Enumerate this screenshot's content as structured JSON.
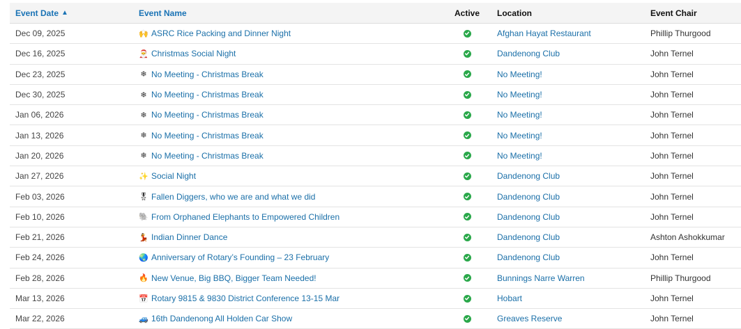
{
  "colors": {
    "link": "#1a6fa8",
    "active": "#2aa84a",
    "header_bg": "#f4f4f4"
  },
  "headers": {
    "date": "Event Date",
    "sort_indicator": "▲",
    "name": "Event Name",
    "active": "Active",
    "location": "Location",
    "chair": "Event Chair"
  },
  "rows": [
    {
      "date": "Dec 09, 2025",
      "icon": "raising-hands-icon",
      "emoji": "🙌",
      "name": "ASRC Rice Packing and Dinner Night",
      "location": "Afghan Hayat Restaurant",
      "chair": "Phillip Thurgood"
    },
    {
      "date": "Dec 16, 2025",
      "icon": "santa-icon",
      "emoji": "🎅",
      "name": "Christmas Social Night",
      "location": "Dandenong Club",
      "chair": "John Ternel"
    },
    {
      "date": "Dec 23, 2025",
      "icon": "snowflake-icon",
      "emoji": "❄",
      "name": "No Meeting - Christmas Break",
      "location": "No Meeting!",
      "chair": "John Ternel"
    },
    {
      "date": "Dec 30, 2025",
      "icon": "snowflake-icon",
      "emoji": "❄",
      "name": "No Meeting - Christmas Break",
      "location": "No Meeting!",
      "chair": "John Ternel"
    },
    {
      "date": "Jan 06, 2026",
      "icon": "snowflake-icon",
      "emoji": "❄",
      "name": "No Meeting - Christmas Break",
      "location": "No Meeting!",
      "chair": "John Ternel"
    },
    {
      "date": "Jan 13, 2026",
      "icon": "snowflake-icon",
      "emoji": "❄",
      "name": "No Meeting - Christmas Break",
      "location": "No Meeting!",
      "chair": "John Ternel"
    },
    {
      "date": "Jan 20, 2026",
      "icon": "snowflake-icon",
      "emoji": "❄",
      "name": "No Meeting - Christmas Break",
      "location": "No Meeting!",
      "chair": "John Ternel"
    },
    {
      "date": "Jan 27, 2026",
      "icon": "sparkles-icon",
      "emoji": "✨",
      "name": "Social Night",
      "location": "Dandenong Club",
      "chair": "John Ternel"
    },
    {
      "date": "Feb 03, 2026",
      "icon": "medal-icon",
      "emoji": "🎖",
      "name": "Fallen Diggers, who we are and what we did",
      "location": "Dandenong Club",
      "chair": "John Ternel"
    },
    {
      "date": "Feb 10, 2026",
      "icon": "elephant-icon",
      "emoji": "🐘",
      "name": "From Orphaned Elephants to Empowered Children",
      "location": "Dandenong Club",
      "chair": "John Ternel"
    },
    {
      "date": "Feb 21, 2026",
      "icon": "dancer-icon",
      "emoji": "💃",
      "name": "Indian Dinner Dance",
      "location": "Dandenong Club",
      "chair": "Ashton Ashokkumar"
    },
    {
      "date": "Feb 24, 2026",
      "icon": "globe-icon",
      "emoji": "🌏",
      "name": "Anniversary of Rotary’s Founding – 23 February",
      "location": "Dandenong Club",
      "chair": "John Ternel"
    },
    {
      "date": "Feb 28, 2026",
      "icon": "fire-icon",
      "emoji": "🔥",
      "name": "New Venue, Big BBQ, Bigger Team Needed!",
      "location": "Bunnings Narre Warren",
      "chair": "Phillip Thurgood"
    },
    {
      "date": "Mar 13, 2026",
      "icon": "calendar-icon",
      "emoji": "📅",
      "name": "Rotary 9815 & 9830 District Conference 13-15 Mar",
      "location": "Hobart",
      "chair": "John Ternel"
    },
    {
      "date": "Mar 22, 2026",
      "icon": "car-icon",
      "emoji": "🚙",
      "name": "16th Dandenong All Holden Car Show",
      "location": "Greaves Reserve",
      "chair": "John Ternel"
    }
  ]
}
